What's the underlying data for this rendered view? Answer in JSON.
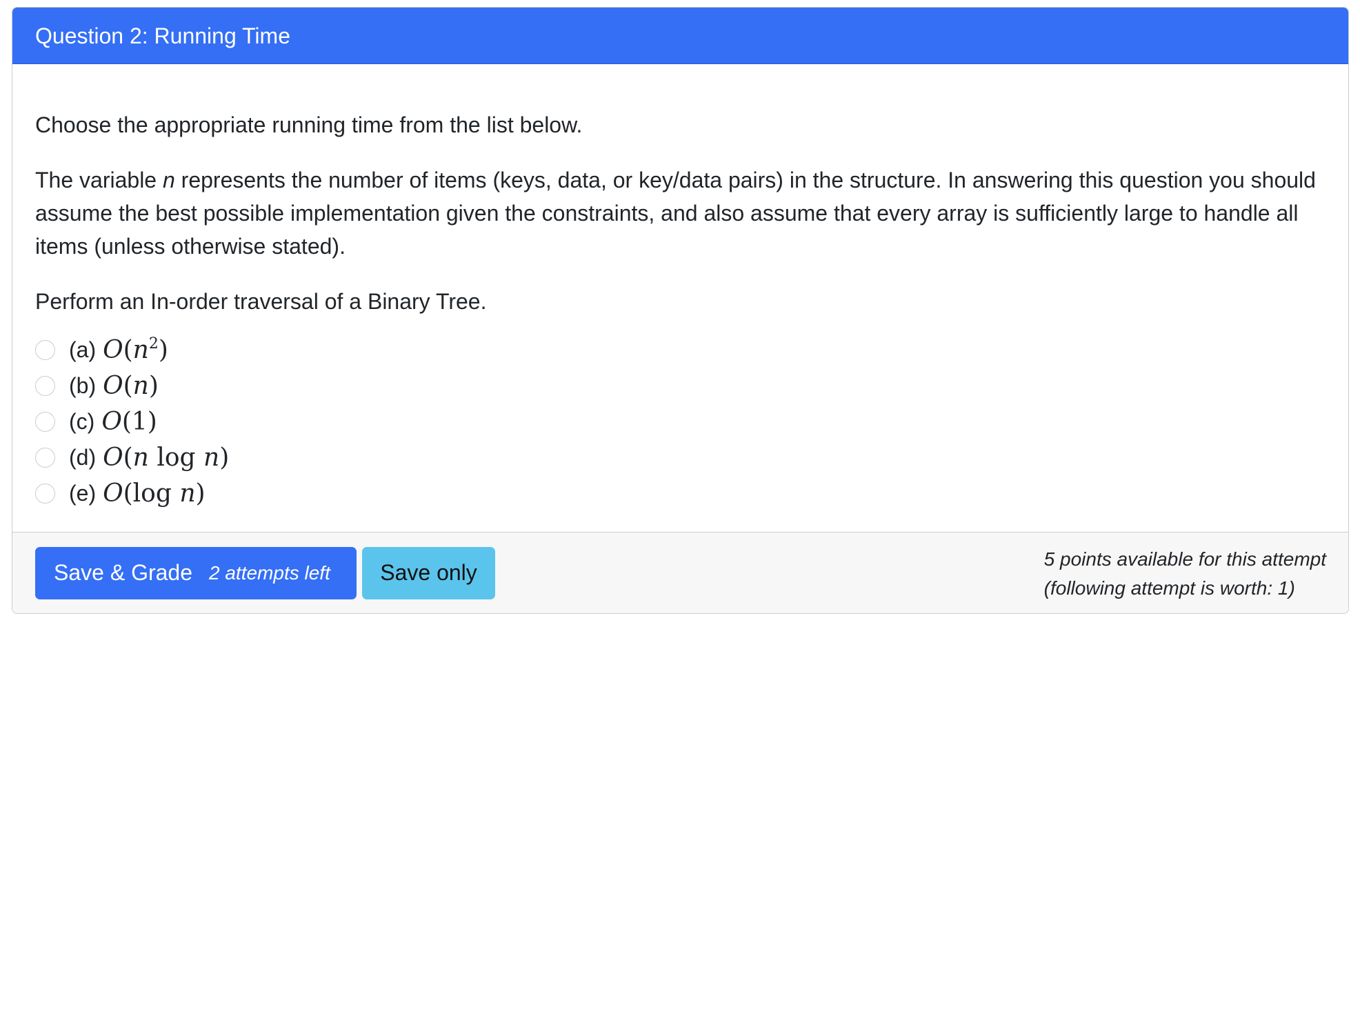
{
  "question": {
    "title": "Question 2: Running Time",
    "intro": "Choose the appropriate running time from the list below.",
    "description_before_var": "The variable ",
    "variable": "n",
    "description_after_var": " represents the number of items (keys, data, or key/data pairs) in the structure. In answering this question you should assume the best possible implementation given the constraints, and also assume that every array is sufficiently large to handle all items (unless otherwise stated).",
    "prompt": "Perform an In-order traversal of a Binary Tree.",
    "options": [
      {
        "letter": "(a)",
        "big_o": "O",
        "open": "(",
        "arg": "n",
        "log": "",
        "exponent": "2",
        "close": ")"
      },
      {
        "letter": "(b)",
        "big_o": "O",
        "open": "(",
        "arg": "n",
        "log": "",
        "exponent": "",
        "close": ")"
      },
      {
        "letter": "(c)",
        "big_o": "O",
        "open": "(",
        "arg": "1",
        "log": "",
        "exponent": "",
        "close": ")"
      },
      {
        "letter": "(d)",
        "big_o": "O",
        "open": "(",
        "arg": "n",
        "log": "log",
        "log_arg": "n",
        "exponent": "",
        "close": ")"
      },
      {
        "letter": "(e)",
        "big_o": "O",
        "open": "(",
        "arg": "",
        "log": "log",
        "log_arg": "n",
        "exponent": "",
        "close": ")"
      }
    ]
  },
  "footer": {
    "grade_label": "Save & Grade",
    "attempts_left": "2 attempts left",
    "save_only_label": "Save only",
    "points_line1": "5 points available for this attempt",
    "points_line2": "(following attempt is worth: 1)"
  },
  "colors": {
    "header_bg": "#346ff5",
    "grade_button": "#346ff5",
    "save_button": "#5bc4ec",
    "footer_bg": "#f7f7f7"
  }
}
